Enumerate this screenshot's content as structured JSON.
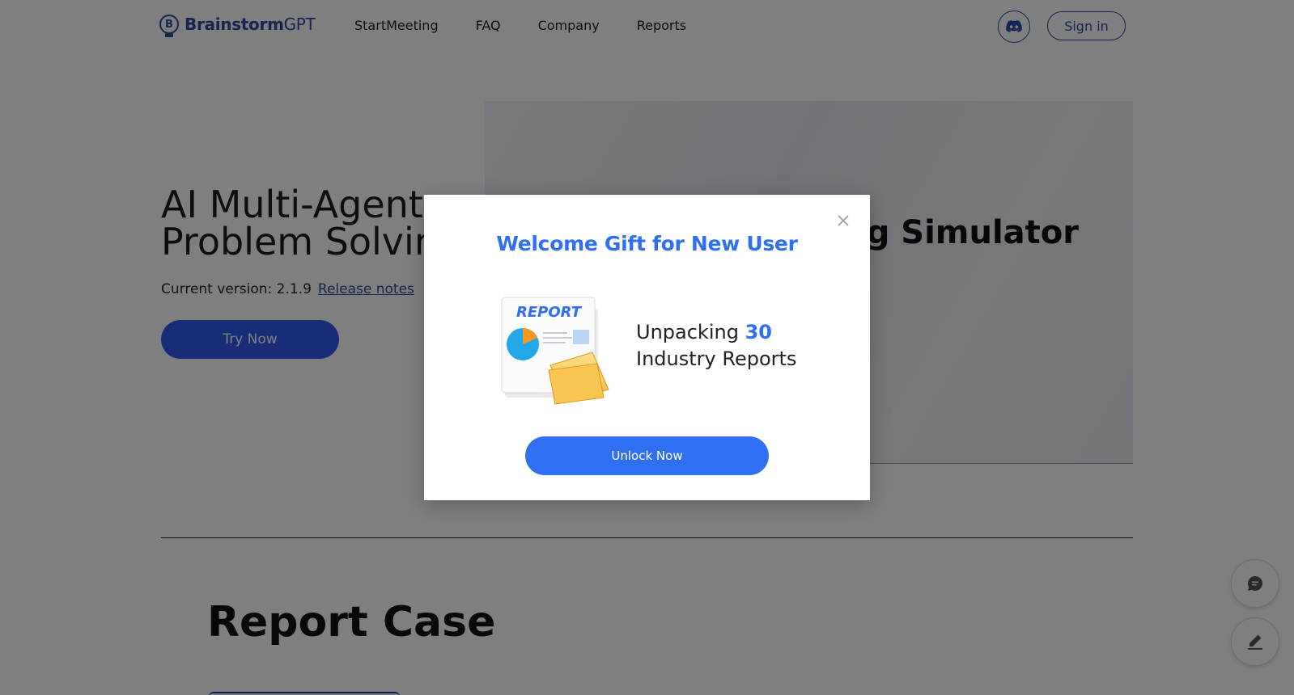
{
  "brand": {
    "name_bold": "Brainstorm",
    "name_light": "GPT",
    "mark_letter": "B"
  },
  "nav": {
    "links": [
      {
        "label": "StartMeeting"
      },
      {
        "label": "FAQ"
      },
      {
        "label": "Company"
      },
      {
        "label": "Reports"
      }
    ],
    "discord_icon": "discord-icon",
    "signin_label": "Sign in"
  },
  "hero": {
    "title_line1": "AI Multi-Agent",
    "title_line2": "Problem Solvin",
    "version_label": "Current version: 2.1.9",
    "release_notes_label": "Release notes",
    "try_now_label": "Try Now",
    "visual_title": "ng Simulator"
  },
  "section": {
    "title": "Report Case"
  },
  "floating_buttons": {
    "chat_icon": "chat-icon",
    "edit_icon": "edit-icon"
  },
  "modal": {
    "title": "Welcome Gift for New User",
    "illustration_label": "REPORT",
    "text_prefix": "Unpacking ",
    "text_number": "30",
    "text_line2": "Industry Reports",
    "unlock_label": "Unlock Now",
    "close_icon": "close-icon"
  },
  "colors": {
    "accent": "#2f6ff0",
    "brand": "#2b4aa8",
    "overlay": "rgba(0,0,0,0.5)"
  }
}
